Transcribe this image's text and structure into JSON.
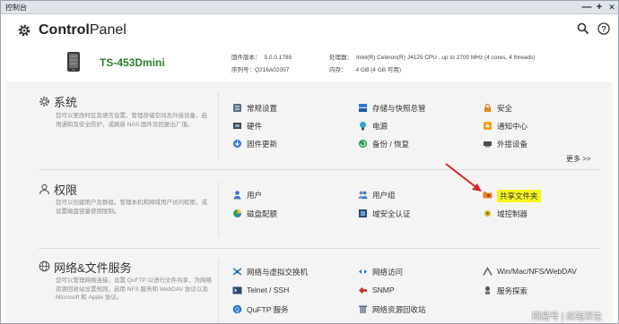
{
  "window": {
    "title": "控制台",
    "minimize": "—",
    "maximize": "+",
    "close": "✕"
  },
  "header": {
    "app_name_bold": "Control",
    "app_name_rest": "Panel"
  },
  "device": {
    "name": "TS-453Dmini",
    "firmware_label": "固件版本：",
    "firmware_value": "5.0.0.1785",
    "serial_label": "序列号：",
    "serial_value": "Q216A02057",
    "cpu_label": "处理器：",
    "cpu_value": "Intel(R) Celeron(R) J4125 CPU , up to 2700 MHz (4 cores, 4 threads)",
    "mem_label": "内存：",
    "mem_value": "4 GB (4 GB 可用)"
  },
  "sections": {
    "system": {
      "title": "系统",
      "desc": "您可以更改时区及语言设置，管理存储空间及外接设备，启用通知及安全防护，或刷新 NAS 固件及回复出厂值。",
      "items": [
        "常规设置",
        "存储与快照总管",
        "安全",
        "硬件",
        "电源",
        "通知中心",
        "固件更新",
        "备份 / 恢复",
        "外接设备"
      ],
      "more": "更多 >>"
    },
    "privilege": {
      "title": "权限",
      "desc": "您可以创建用户及群组，管理本机和网域用户访问权限，或设置磁盘容量使用限制。",
      "items": [
        "用户",
        "用户组",
        "共享文件夹",
        "磁盘配额",
        "域安全认证",
        "域控制器"
      ]
    },
    "network": {
      "title": "网络&文件服务",
      "desc": "您可以管理网络连接，设置 QuFTP 以进行文件共享，为网络资源回收站设置规则，启用 NFS 服务和 WebDAV 协议以及 Microsoft 和 Apple 协议。",
      "items": [
        "网络与虚拟交换机",
        "网络访问",
        "Win/Mac/NFS/WebDAV",
        "Telnet / SSH",
        "SNMP",
        "服务探索",
        "QuFTP 服务",
        "网络资源回收站"
      ]
    }
  },
  "watermark": "网易号 | 纵笔浮生",
  "colors": {
    "highlight": "#f7f41a",
    "arrow": "#d9262b",
    "device_name": "#2f7d32",
    "accent_blue": "#2b7bd3"
  }
}
